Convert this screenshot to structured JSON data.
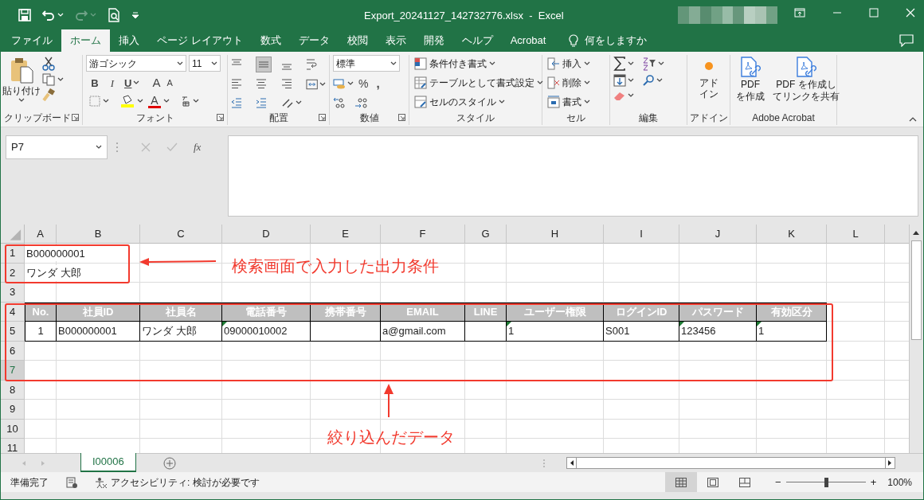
{
  "title_bar": {
    "title": "Export_20241127_142732776.xlsx  -  Excel"
  },
  "ribbon_tabs": [
    {
      "label": "ファイル",
      "selected": false
    },
    {
      "label": "ホーム",
      "selected": true
    },
    {
      "label": "挿入",
      "selected": false
    },
    {
      "label": "ページ レイアウト",
      "selected": false
    },
    {
      "label": "数式",
      "selected": false
    },
    {
      "label": "データ",
      "selected": false
    },
    {
      "label": "校閲",
      "selected": false
    },
    {
      "label": "表示",
      "selected": false
    },
    {
      "label": "開発",
      "selected": false
    },
    {
      "label": "ヘルプ",
      "selected": false
    },
    {
      "label": "Acrobat",
      "selected": false
    }
  ],
  "tell_me": {
    "placeholder": "何をしますか"
  },
  "ribbon_groups": [
    {
      "kind": "clipboard",
      "label": "クリップボード",
      "paste": "貼り付け"
    },
    {
      "kind": "font",
      "label": "フォント",
      "font": "游ゴシック",
      "size": "11",
      "bold": "B",
      "italic": "I",
      "underline": "U",
      "grow": "A",
      "shrink": "A",
      "font_color": "A"
    },
    {
      "kind": "alignment",
      "label": "配置"
    },
    {
      "kind": "number",
      "label": "数値",
      "format": "標準",
      "percent": "%",
      "comma": ","
    },
    {
      "kind": "styles",
      "label": "スタイル",
      "items": [
        "条件付き書式",
        "テーブルとして書式設定",
        "セルのスタイル"
      ]
    },
    {
      "kind": "cells",
      "label": "セル",
      "items": [
        "挿入",
        "削除",
        "書式"
      ]
    },
    {
      "kind": "editing",
      "label": "編集"
    },
    {
      "kind": "addins",
      "label": "アドイン",
      "button": [
        "アド",
        "イン"
      ]
    },
    {
      "kind": "acrobat",
      "label": "Adobe Acrobat",
      "buttons": [
        [
          "PDF",
          "を作成"
        ],
        [
          "PDF を作成し",
          "てリンクを共有"
        ]
      ]
    }
  ],
  "formula_bar": {
    "name_box": "P7",
    "fx": "fx"
  },
  "sheet": {
    "columns": [
      "A",
      "B",
      "C",
      "D",
      "E",
      "F",
      "G",
      "H",
      "I",
      "J",
      "K",
      "L"
    ],
    "rows": [
      {
        "label": "1",
        "selected": false,
        "cells": [
          {
            "text": "B000000001"
          }
        ]
      },
      {
        "label": "2",
        "selected": false,
        "cells": [
          {
            "text": "ワンダ 大郎"
          }
        ]
      },
      {
        "label": "3",
        "selected": false
      },
      {
        "label": "4",
        "selected": false,
        "kind": "header",
        "cells": [
          {
            "text": "No."
          },
          {
            "text": "社員ID"
          },
          {
            "text": "社員名"
          },
          {
            "text": "電話番号"
          },
          {
            "text": "携帯番号"
          },
          {
            "text": "EMAIL"
          },
          {
            "text": "LINE"
          },
          {
            "text": "ユーザー権限"
          },
          {
            "text": "ログインID"
          },
          {
            "text": "パスワード"
          },
          {
            "text": "有効区分"
          }
        ]
      },
      {
        "label": "5",
        "selected": false,
        "kind": "data",
        "cells": [
          {
            "text": "1"
          },
          {
            "text": "B000000001"
          },
          {
            "text": "ワンダ 大郎"
          },
          {
            "text": "09000010002",
            "flag": true
          },
          {},
          {
            "text": "a@gmail.com"
          },
          {},
          {
            "text": "1",
            "flag": true
          },
          {
            "text": "S001"
          },
          {
            "text": "123456",
            "flag": true
          },
          {
            "text": "1",
            "flag": true
          }
        ]
      },
      {
        "label": "6",
        "selected": false
      },
      {
        "label": "7",
        "selected": true
      },
      {
        "label": "8",
        "selected": false
      },
      {
        "label": "9",
        "selected": false
      },
      {
        "label": "10",
        "selected": false
      },
      {
        "label": "11",
        "selected": false
      }
    ]
  },
  "annotations": [
    {
      "text": "検索画面で入力した出力条件"
    },
    {
      "text": "絞り込んだデータ"
    }
  ],
  "sheet_tabs": [
    {
      "label": "I00006",
      "selected": true
    }
  ],
  "status_bar": {
    "ready": "準備完了",
    "accessibility": "アクセシビリティ: 検討が必要です",
    "zoom_out": "−",
    "zoom_in": "+",
    "level": 0.5,
    "zoom": "100%"
  }
}
